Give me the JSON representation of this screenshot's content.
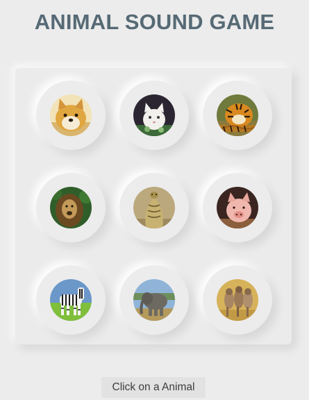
{
  "page": {
    "title": "ANIMAL SOUND GAME",
    "status_text": "Click on a Animal"
  },
  "colors": {
    "background": "#ececec",
    "title": "#566a75"
  },
  "board": {
    "animals": [
      {
        "name": "dog",
        "icon": "doge-photo"
      },
      {
        "name": "cat",
        "icon": "cat-photo"
      },
      {
        "name": "tiger",
        "icon": "tiger-photo"
      },
      {
        "name": "lion",
        "icon": "lion-photo"
      },
      {
        "name": "cobra",
        "icon": "cobra-photo"
      },
      {
        "name": "pig",
        "icon": "pig-photo"
      },
      {
        "name": "zebra",
        "icon": "zebra-photo"
      },
      {
        "name": "elephant",
        "icon": "elephant-photo"
      },
      {
        "name": "hyena",
        "icon": "hyena-photo"
      }
    ]
  }
}
